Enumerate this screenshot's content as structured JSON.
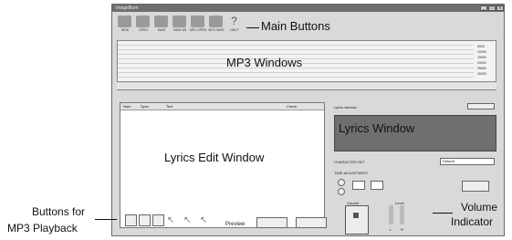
{
  "window": {
    "title": "ImageBurn",
    "controls": [
      "_",
      "□",
      "x"
    ]
  },
  "toolbar": {
    "buttons": [
      "NEW",
      "OPEN",
      "SAVE",
      "SAVE AS",
      "MP3 OPEN",
      "MP3 SAVE",
      "HELP"
    ]
  },
  "mp3": {
    "right_scale": [
      "5000",
      "10000",
      "15000",
      "20000",
      "25000",
      "30000"
    ]
  },
  "lyrics_table": {
    "headers": [
      "Num",
      "Sync",
      "Text",
      "Check"
    ]
  },
  "right_panel": {
    "lyrics_window_header": "Lyrics window",
    "character_set_label": "CHARACTER SET",
    "character_set_value": "Default",
    "time_adjustment_label": "TIME ADJUSTMENT",
    "volume_label": "Volume",
    "level_label": "Level",
    "level_channels": [
      "L",
      "R"
    ]
  },
  "bottom": {
    "preview_label": "Preview"
  },
  "callouts": {
    "main_buttons": "Main Buttons",
    "mp3_windows": "MP3 Windows",
    "lyrics_edit": "Lyrics Edit Window",
    "lyrics_window": "Lyrics Window",
    "buttons_for": "Buttons for",
    "mp3_playback": "MP3 Playback",
    "volume": "Volume",
    "indicator": "Indicator"
  }
}
